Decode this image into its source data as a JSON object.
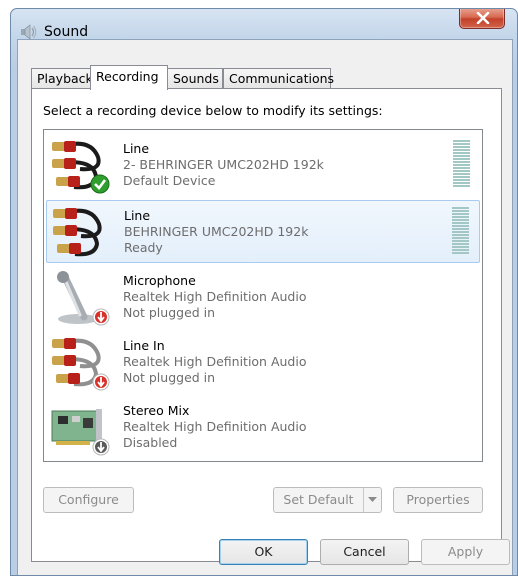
{
  "window": {
    "title": "Sound"
  },
  "tabs": [
    {
      "label": "Playback"
    },
    {
      "label": "Recording"
    },
    {
      "label": "Sounds"
    },
    {
      "label": "Communications"
    }
  ],
  "instruction": "Select a recording device below to modify its settings:",
  "devices": [
    {
      "name": "Line",
      "detail": "2- BEHRINGER UMC202HD 192k",
      "status": "Default Device",
      "icon": "line-cable-icon",
      "badge": "green-check-icon",
      "selected": false,
      "meter": true
    },
    {
      "name": "Line",
      "detail": "BEHRINGER UMC202HD 192k",
      "status": "Ready",
      "icon": "line-cable-icon",
      "badge": "",
      "selected": true,
      "meter": true
    },
    {
      "name": "Microphone",
      "detail": "Realtek High Definition Audio",
      "status": "Not plugged in",
      "icon": "microphone-icon",
      "badge": "red-down-arrow-icon",
      "selected": false,
      "meter": false
    },
    {
      "name": "Line In",
      "detail": "Realtek High Definition Audio",
      "status": "Not plugged in",
      "icon": "line-cable-icon",
      "badge": "red-down-arrow-icon",
      "selected": false,
      "meter": false
    },
    {
      "name": "Stereo Mix",
      "detail": "Realtek High Definition Audio",
      "status": "Disabled",
      "icon": "sound-card-icon",
      "badge": "gray-down-arrow-icon",
      "selected": false,
      "meter": false
    }
  ],
  "buttons": {
    "configure": "Configure",
    "set_default": "Set Default",
    "properties": "Properties",
    "ok": "OK",
    "cancel": "Cancel",
    "apply": "Apply"
  },
  "colors": {
    "selection_border": "#a9cbef",
    "meter": "#a3c7c5",
    "close_red": "#c2412a",
    "check_green": "#2f9e2f"
  }
}
